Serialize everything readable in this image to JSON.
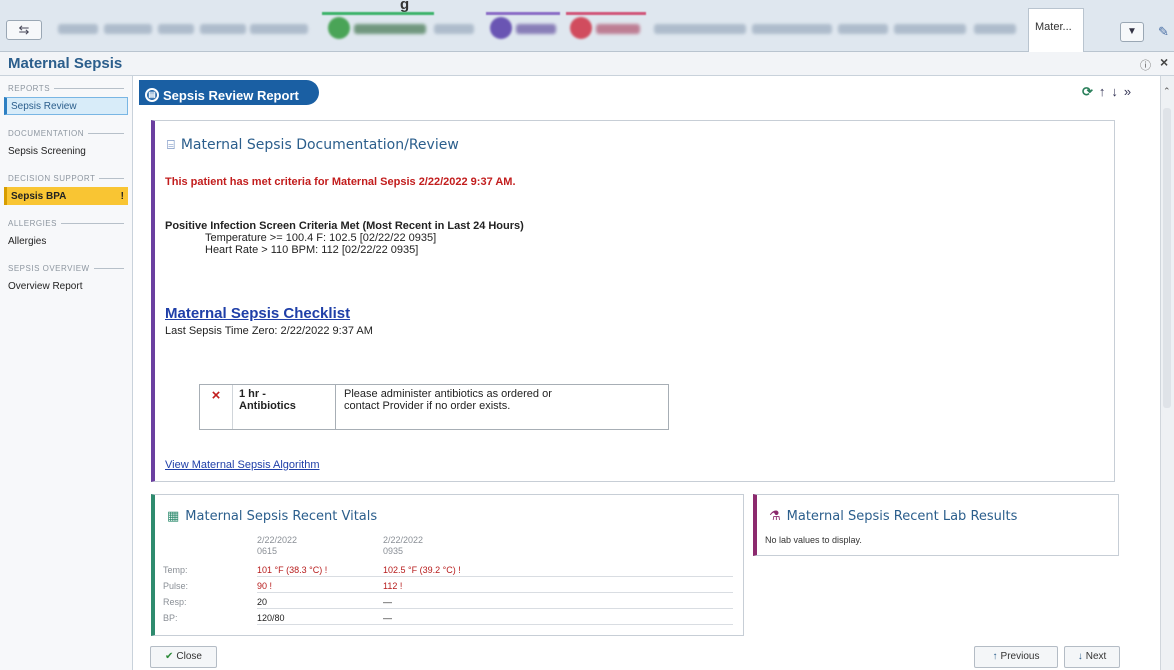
{
  "window": {
    "heading": "g",
    "active_tab": "Mater..."
  },
  "title_bar": {
    "title": "Maternal Sepsis",
    "help_icon": "help-icon",
    "close_label": "×"
  },
  "nav": {
    "sections": [
      {
        "header": "Reports",
        "items": [
          {
            "label": "Sepsis Review",
            "selected": true
          }
        ]
      },
      {
        "header": "Documentation",
        "items": [
          {
            "label": "Sepsis Screening"
          }
        ]
      },
      {
        "header": "Decision Support",
        "items": [
          {
            "label": "Sepsis BPA",
            "badge": "!"
          }
        ]
      },
      {
        "header": "Allergies",
        "items": [
          {
            "label": "Allergies"
          }
        ]
      },
      {
        "header": "Sepsis Overview",
        "items": [
          {
            "label": "Overview Report"
          }
        ]
      }
    ]
  },
  "report": {
    "title": "Sepsis Review Report",
    "icon": "report-icon",
    "actions": [
      "refresh-icon",
      "arrow-up-icon",
      "arrow-down-icon",
      "collapse-icon"
    ]
  },
  "documentation": {
    "title": "Maternal Sepsis Documentation/Review",
    "alert": "This patient has met criteria for Maternal Sepsis 2/22/2022  9:37 AM.",
    "criteria_heading": "Positive Infection Screen Criteria Met (Most Recent in Last 24 Hours)",
    "criteria": [
      "Temperature >= 100.4 F:  102.5 [02/22/22 0935]",
      "Heart Rate > 110 BPM:  112 [02/22/22 0935]"
    ],
    "checklist_link": "Maternal Sepsis Checklist",
    "time_zero": "Last Sepsis Time Zero: 2/22/2022  9:37 AM",
    "task": {
      "status_icon": "×",
      "name_line1": "1 hr -",
      "name_line2": "Antibiotics",
      "instruction_line1": "Please administer antibiotics as ordered or",
      "instruction_line2": "contact Provider if no order exists."
    },
    "algorithm_link": "View Maternal Sepsis Algorithm"
  },
  "vitals": {
    "title": "Maternal Sepsis Recent Vitals",
    "columns": [
      {
        "date": "2/22/2022",
        "time": "0615"
      },
      {
        "date": "2/22/2022",
        "time": "0935"
      }
    ],
    "rows": [
      {
        "label": "Temp:",
        "v1": "101 °F (38.3 °C) !",
        "v2": "102.5 °F (39.2 °C) !",
        "abnormal": true
      },
      {
        "label": "Pulse:",
        "v1": "90 !",
        "v2": "112 !",
        "abnormal": true
      },
      {
        "label": "Resp:",
        "v1": "20",
        "v2": "—",
        "abnormal": false
      },
      {
        "label": "BP:",
        "v1": "120/80",
        "v2": "—",
        "abnormal": false
      }
    ]
  },
  "labs": {
    "title": "Maternal Sepsis Recent Lab Results",
    "empty_message": "No lab values to display."
  },
  "buttons": {
    "close": "Close",
    "previous": "Previous",
    "next": "Next"
  },
  "colors": {
    "brand_blue": "#1a5fa3",
    "alert_red": "#c21d1d",
    "bpa_yellow": "#f9c533",
    "doc_accent": "#6b3fa0",
    "vitals_accent": "#2e8b6e",
    "labs_accent": "#8c2a6e"
  }
}
